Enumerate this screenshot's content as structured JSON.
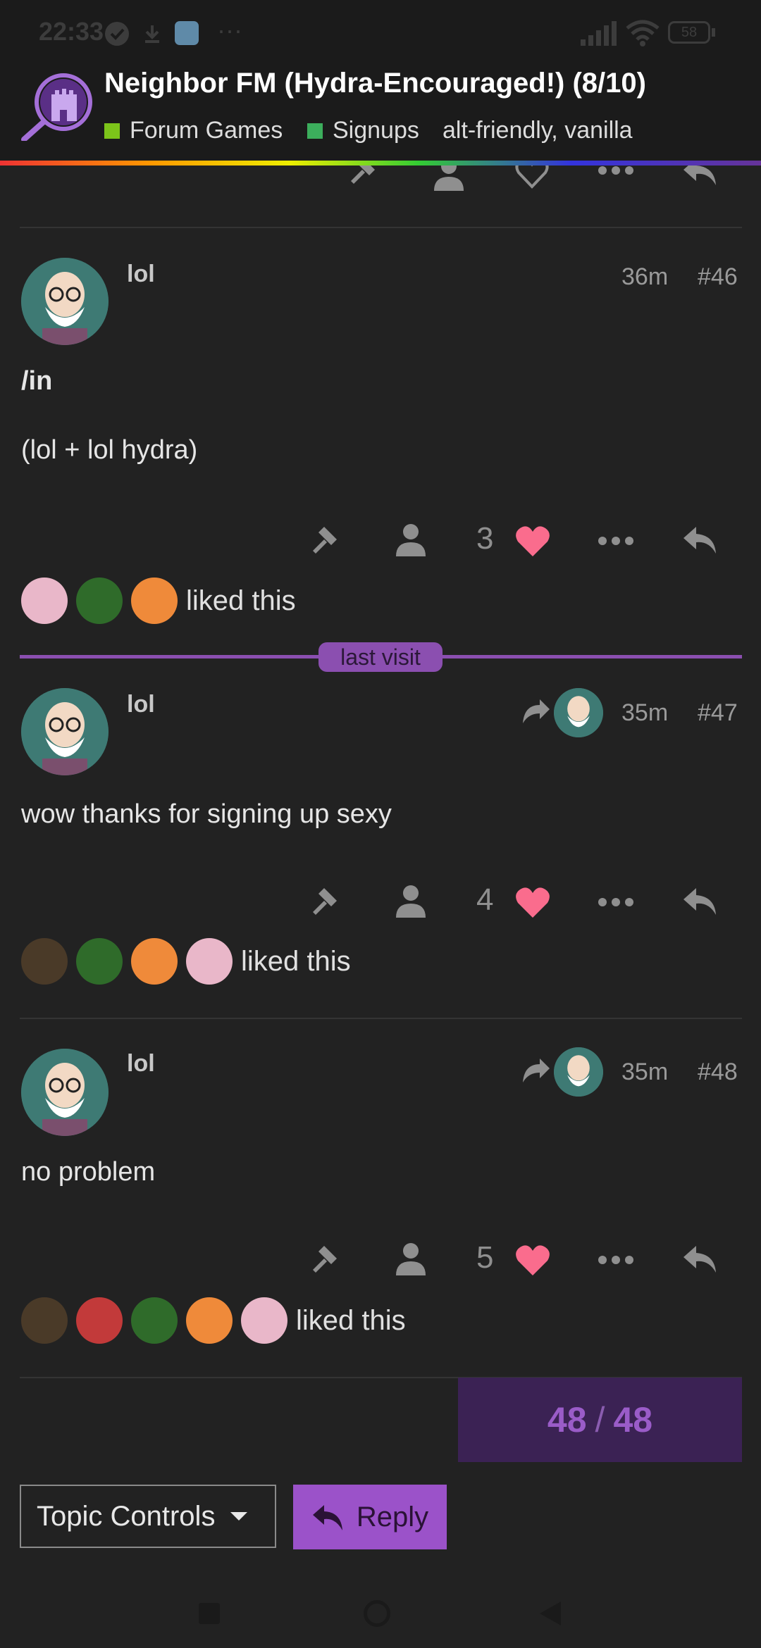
{
  "status_bar": {
    "time": "22:33",
    "battery": "58",
    "more": "···"
  },
  "topic": {
    "title": "Neighbor FM (Hydra-Encouraged!) (8/10)",
    "categories": [
      {
        "name": "Forum Games",
        "color": "#7cc41a"
      },
      {
        "name": "Signups",
        "color": "#3cae5c"
      }
    ],
    "tags": "alt-friendly,  vanilla"
  },
  "colors": {
    "accent": "#9b52c9",
    "heart": "#fa6c8d",
    "background": "#222222"
  },
  "posts": [
    {
      "username": "lol",
      "age": "36m",
      "number": "#46",
      "line1": "/in",
      "line2": "(lol + lol hydra)",
      "likes": "3",
      "liked_text": "liked this"
    },
    {
      "username": "lol",
      "age": "35m",
      "number": "#47",
      "body": "wow thanks for signing up sexy",
      "likes": "4",
      "liked_text": "liked this"
    },
    {
      "username": "lol",
      "age": "35m",
      "number": "#48",
      "body": "no problem",
      "likes": "5",
      "liked_text": "liked this"
    }
  ],
  "last_visit_label": "last visit",
  "progress": {
    "current": "48",
    "total": "48"
  },
  "controls": {
    "topic_controls_label": "Topic Controls",
    "reply_label": "Reply"
  },
  "icons": [
    "gavel-icon",
    "user-icon",
    "heart-icon",
    "more-icon",
    "reply-icon",
    "share-icon",
    "caret-down-icon"
  ]
}
